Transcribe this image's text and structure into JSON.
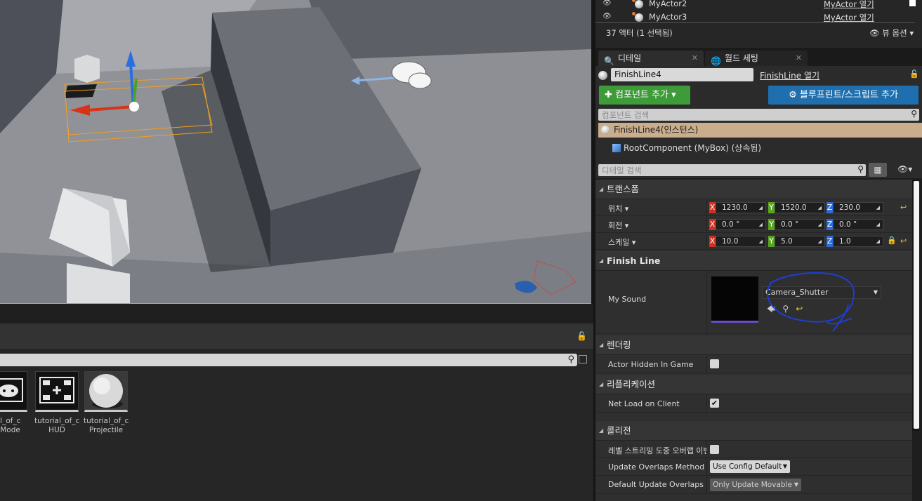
{
  "outliner": {
    "rows": [
      {
        "name": "MyActor2",
        "link": "MyActor 열기"
      },
      {
        "name": "MyActor3",
        "link": "MyActor 열기"
      }
    ],
    "count": "37 액터 (1 선택됨)",
    "view_options": "뷰 옵션"
  },
  "tabs": [
    {
      "label": "디테일",
      "icon": "magnifier-icon"
    },
    {
      "label": "월드 세팅",
      "icon": "globe-icon"
    }
  ],
  "details": {
    "actor_name": "FinishLine4",
    "open_link": "FinishLine 열기",
    "add_component": "컴포넌트 추가",
    "add_blueprint": "블루프린트/스크립트 추가",
    "component_search_placeholder": "컴포넌트 검색",
    "instance_label": "FinishLine4(인스턴스)",
    "root_component": "RootComponent (MyBox) (상속됨)",
    "detail_search_placeholder": "디테일 검색"
  },
  "transform": {
    "category": "트랜스폼",
    "location": {
      "label": "위치",
      "x": "1230.0",
      "y": "1520.0",
      "z": "230.0"
    },
    "rotation": {
      "label": "회전",
      "x": "0.0 °",
      "y": "0.0 °",
      "z": "0.0 °"
    },
    "scale": {
      "label": "스케일",
      "x": "10.0",
      "y": "5.0",
      "z": "1.0"
    }
  },
  "finish_line": {
    "category": "Finish Line",
    "my_sound_label": "My Sound",
    "sound_value": "Camera_Shutter"
  },
  "rendering": {
    "category": "렌더링",
    "actor_hidden_label": "Actor Hidden In Game",
    "actor_hidden_checked": false
  },
  "replication": {
    "category": "리플리케이션",
    "net_load_label": "Net Load on Client",
    "net_load_checked": true
  },
  "collision": {
    "category": "콜리전",
    "streaming_label": "레벨 스트리밍 도중 오버랩 이벤",
    "update_method_label": "Update Overlaps Method Du",
    "update_method_value": "Use Config Default",
    "default_update_label": "Default Update Overlaps Me",
    "default_update_value": "Only Update Movable"
  },
  "content_browser": {
    "assets": [
      {
        "line1": "rial_of_c",
        "line2": "neMode",
        "icon": "gamepad-icon"
      },
      {
        "line1": "tutorial_of_c",
        "line2": "HUD",
        "icon": "hud-icon"
      },
      {
        "line1": "tutorial_of_c",
        "line2": "Projectile",
        "icon": "sphere-icon"
      }
    ]
  },
  "colors": {
    "accent_green": "#3f9a3a",
    "accent_blue": "#1f6fae",
    "axis_x": "#d03020",
    "axis_y": "#5aa520",
    "axis_z": "#2d6bd8",
    "selection_orange": "#d9a23a"
  }
}
